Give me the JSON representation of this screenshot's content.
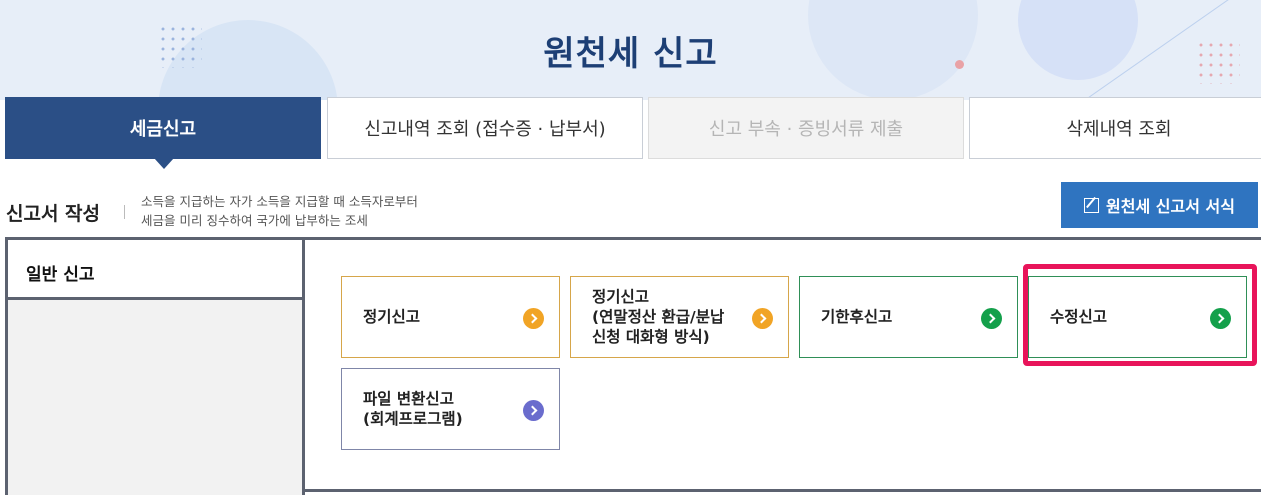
{
  "page": {
    "title": "원천세 신고"
  },
  "tabs": [
    {
      "label": "세금신고",
      "active": true
    },
    {
      "label": "신고내역 조회 (접수증 · 납부서)",
      "active": false
    },
    {
      "label": "신고 부속 · 증빙서류 제출",
      "active": false,
      "disabled": true
    },
    {
      "label": "삭제내역 조회",
      "active": false
    }
  ],
  "section": {
    "title": "신고서 작성",
    "description_line1": "소득을 지급하는 자가 소득을 지급할 때 소득자로부터",
    "description_line2": "세금을 미리 징수하여 국가에 납부하는 조세",
    "form_button": {
      "label": "원천세 신고서 서식",
      "icon": "edit-icon"
    }
  },
  "panel": {
    "side_tab_label": "일반 신고",
    "cards": [
      {
        "label": "정기신고",
        "color": "#f1a425"
      },
      {
        "label": "정기신고\n(연말정산 환급/분납\n신청 대화형 방식)",
        "color": "#f1a425"
      },
      {
        "label": "기한후신고",
        "color": "#14a04b"
      },
      {
        "label": "수정신고",
        "color": "#14a04b",
        "highlighted": true
      },
      {
        "label": "파일 변환신고\n(회계프로그램)",
        "color": "#6a6ccd"
      }
    ]
  },
  "colors": {
    "primary": "#2b4f86",
    "button": "#2f74c0",
    "highlight": "#e8145a",
    "title": "#1d3f75"
  }
}
